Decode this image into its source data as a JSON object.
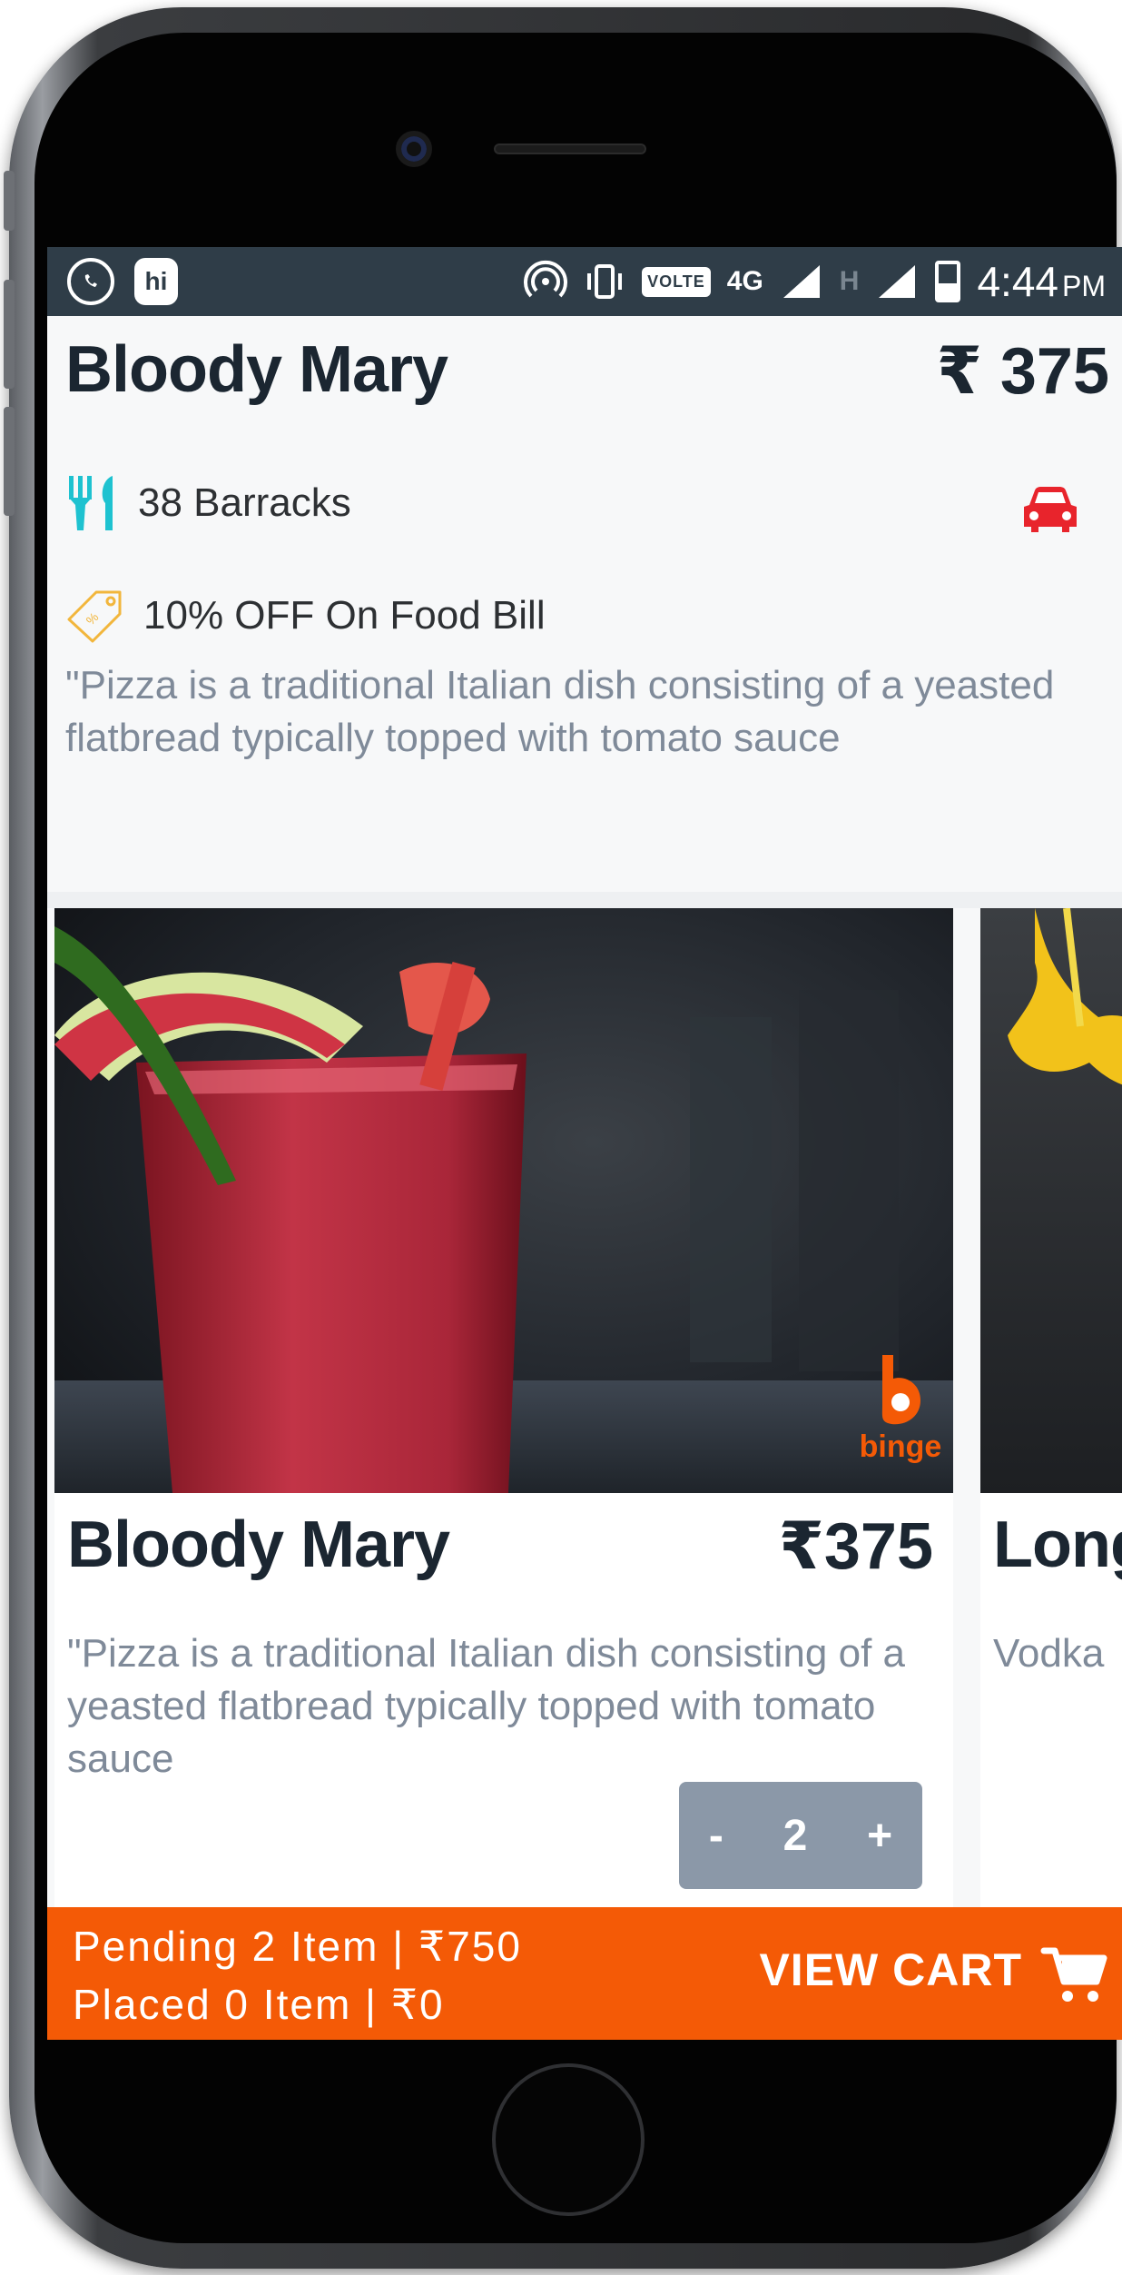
{
  "status_bar": {
    "apps": [
      "whatsapp-icon",
      "hike-hi-icon"
    ],
    "hi_label": "hi",
    "volte": "VOLTE",
    "network": "4G",
    "network2": "H",
    "time": "4:44",
    "ampm": "PM"
  },
  "item": {
    "title": "Bloody Mary",
    "price": "₹ 375",
    "restaurant": "38 Barracks",
    "offer": "10% OFF On Food Bill",
    "description": "\"Pizza is a traditional Italian dish consisting of a yeasted flatbread typically topped with tomato sauce"
  },
  "cards": [
    {
      "title": "Bloody Mary",
      "price": "₹375",
      "description": "\"Pizza is a traditional Italian dish consisting of a yeasted flatbread typically topped with tomato sauce",
      "quantity": "2",
      "minus": "-",
      "plus": "+",
      "logo_text": "binge"
    },
    {
      "title": "Long",
      "description": "Vodka"
    }
  ],
  "cart_bar": {
    "pending": "Pending 2 Item | ₹750",
    "placed": "Placed 0 Item | ₹0",
    "view_cart": "VIEW CART"
  },
  "colors": {
    "accent": "#f45a06",
    "status_bar": "#2f3d48",
    "restaurant_icon": "#1ec2d0",
    "car_icon": "#e8242c",
    "stepper": "#8b98a8"
  }
}
